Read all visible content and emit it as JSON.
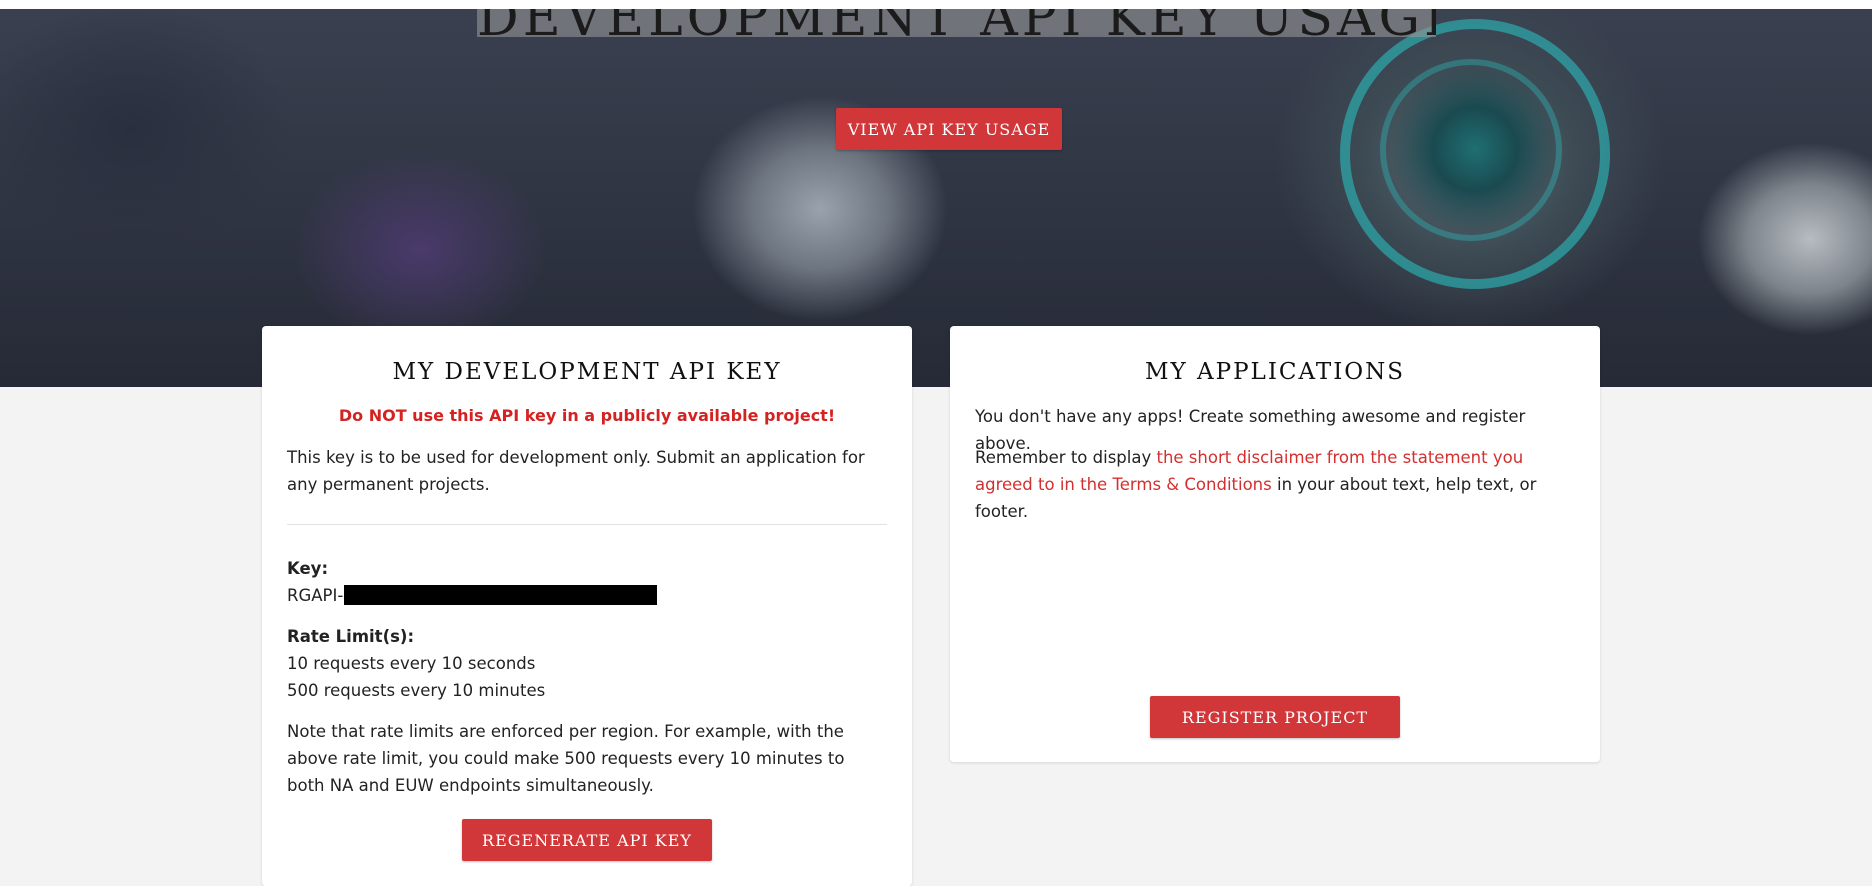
{
  "hero": {
    "title": "DEVELOPMENT API KEY USAGE",
    "view_usage_button": "VIEW API KEY USAGE"
  },
  "dev_key_card": {
    "title": "MY DEVELOPMENT API KEY",
    "warning": "Do NOT use this API key in a publicly available project!",
    "description": "This key is to be used for development only. Submit an application for any permanent projects.",
    "key_label": "Key:",
    "key_prefix": "RGAPI-",
    "rate_limits_label": "Rate Limit(s):",
    "rate_limits": [
      "10 requests every 10 seconds",
      "500 requests every 10 minutes"
    ],
    "note": "Note that rate limits are enforced per region. For example, with the above rate limit, you could make 500 requests every 10 minutes to both NA and EUW endpoints simultaneously.",
    "regenerate_button": "REGENERATE API KEY"
  },
  "applications_card": {
    "title": "MY APPLICATIONS",
    "empty_text": "You don't have any apps! Create something awesome and register above.",
    "remember_prefix": "Remember to display ",
    "remember_link": "the short disclaimer from the statement you agreed to in the Terms & Conditions",
    "remember_suffix": " in your about text, help text, or footer.",
    "register_button": "REGISTER PROJECT"
  },
  "colors": {
    "accent": "#d13639",
    "warning": "#d42222",
    "link": "#d42f2f",
    "page_bg": "#f3f3f3"
  }
}
